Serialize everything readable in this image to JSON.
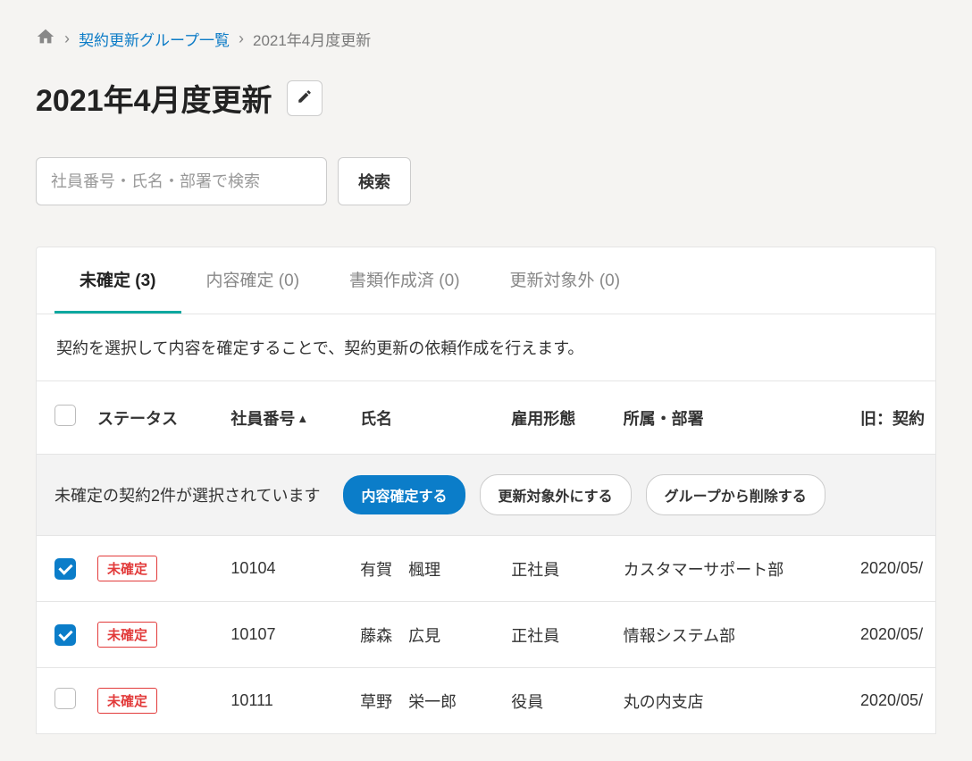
{
  "breadcrumb": {
    "link_text": "契約更新グループ一覧",
    "current": "2021年4月度更新"
  },
  "page": {
    "title": "2021年4月度更新"
  },
  "search": {
    "placeholder": "社員番号・氏名・部署で検索",
    "button_label": "検索"
  },
  "tabs": [
    {
      "label": "未確定 (3)",
      "active": true
    },
    {
      "label": "内容確定 (0)",
      "active": false
    },
    {
      "label": "書類作成済 (0)",
      "active": false
    },
    {
      "label": "更新対象外 (0)",
      "active": false
    }
  ],
  "info_text": "契約を選択して内容を確定することで、契約更新の依頼作成を行えます。",
  "columns": {
    "status": "ステータス",
    "emp_no": "社員番号",
    "name": "氏名",
    "emp_type": "雇用形態",
    "dept": "所属・部署",
    "old_contract": "旧：契約"
  },
  "action_bar": {
    "text": "未確定の契約2件が選択されています",
    "confirm": "内容確定する",
    "exclude": "更新対象外にする",
    "remove": "グループから削除する"
  },
  "rows": [
    {
      "checked": true,
      "status": "未確定",
      "emp_no": "10104",
      "name": "有賀　楓理",
      "emp_type": "正社員",
      "dept": "カスタマーサポート部",
      "old_date": "2020/05/"
    },
    {
      "checked": true,
      "status": "未確定",
      "emp_no": "10107",
      "name": "藤森　広見",
      "emp_type": "正社員",
      "dept": "情報システム部",
      "old_date": "2020/05/"
    },
    {
      "checked": false,
      "status": "未確定",
      "emp_no": "10111",
      "name": "草野　栄一郎",
      "emp_type": "役員",
      "dept": "丸の内支店",
      "old_date": "2020/05/"
    }
  ]
}
